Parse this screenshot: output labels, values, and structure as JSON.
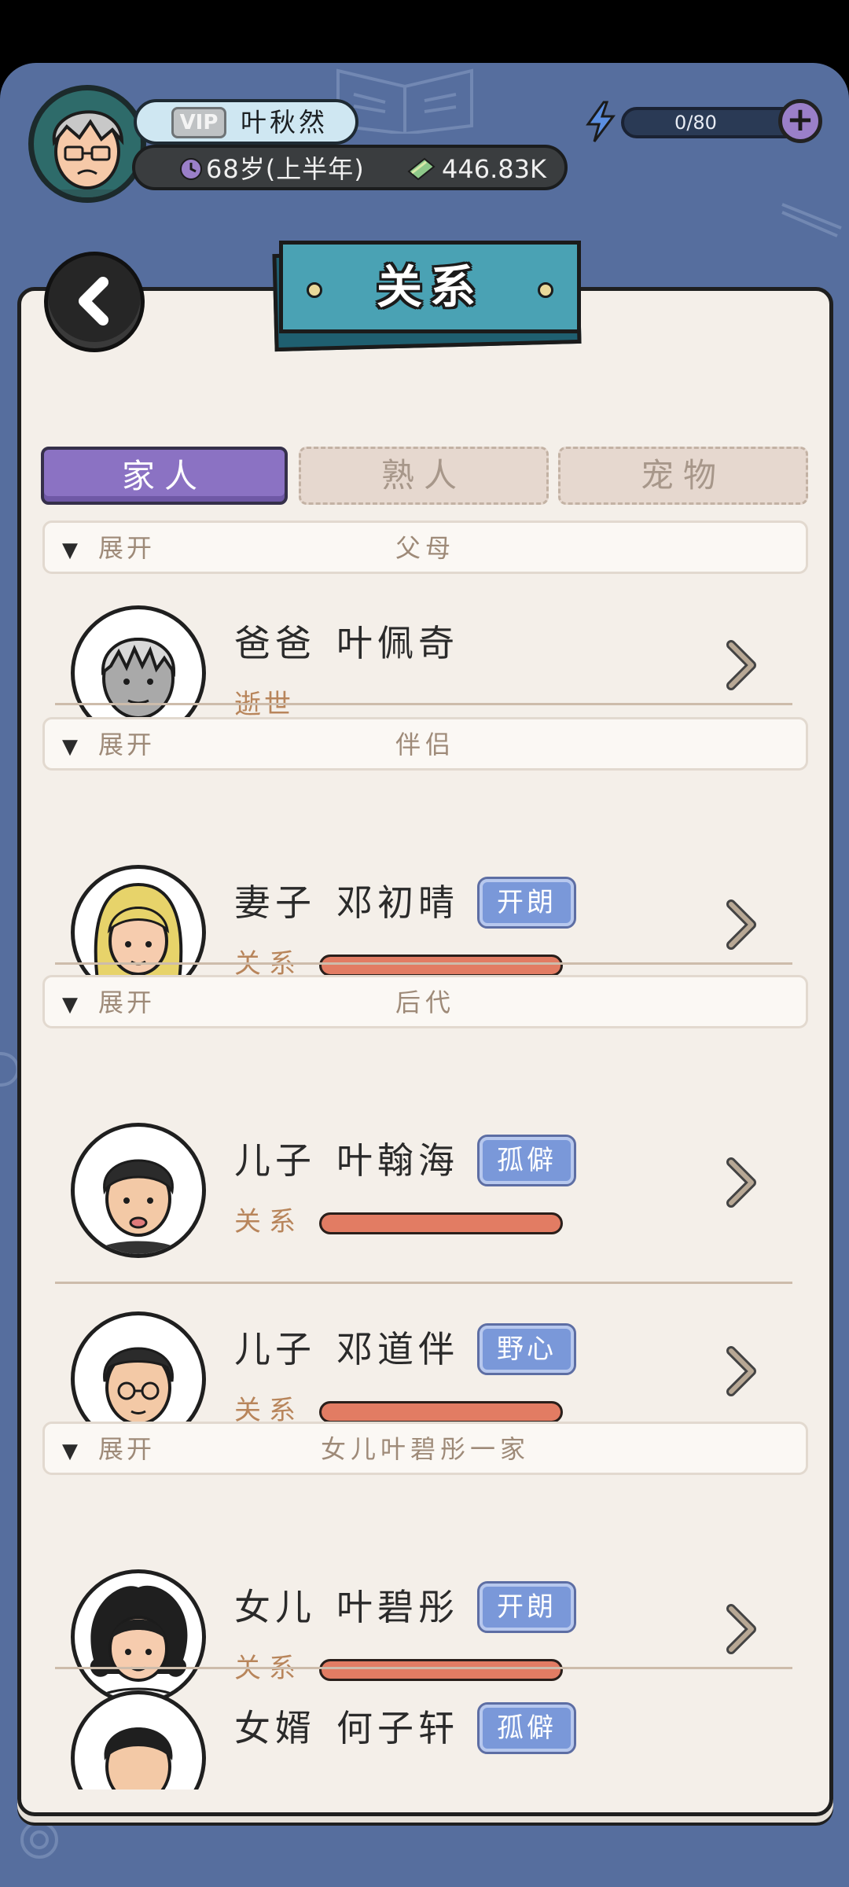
{
  "header": {
    "vip_label": "VIP",
    "player_name": "叶秋然",
    "age_text": "68岁(上半年)",
    "money_text": "446.83K",
    "energy_text": "0/80",
    "energy_value": 0,
    "energy_max": 80
  },
  "page": {
    "title": "关系"
  },
  "tabs": [
    {
      "label": "家人",
      "active": true
    },
    {
      "label": "熟人",
      "active": false
    },
    {
      "label": "宠物",
      "active": false
    }
  ],
  "sections": [
    {
      "expand_label": "展开",
      "title": "父母"
    },
    {
      "expand_label": "展开",
      "title": "伴侣"
    },
    {
      "expand_label": "展开",
      "title": "后代"
    },
    {
      "expand_label": "展开",
      "title": "女儿叶碧彤一家"
    }
  ],
  "people": [
    {
      "role": "爸爸",
      "name": "叶佩奇",
      "status": "逝世",
      "trait": ""
    },
    {
      "role": "妻子",
      "name": "邓初晴",
      "trait": "开朗",
      "relation_label": "关系",
      "relation_value": 1.0
    },
    {
      "role": "儿子",
      "name": "叶翰海",
      "trait": "孤僻",
      "relation_label": "关系",
      "relation_value": 1.0
    },
    {
      "role": "儿子",
      "name": "邓道伴",
      "trait": "野心",
      "relation_label": "关系",
      "relation_value": 1.0
    },
    {
      "role": "女儿",
      "name": "叶碧彤",
      "trait": "开朗",
      "relation_label": "关系",
      "relation_value": 1.0
    },
    {
      "role": "女婿",
      "name": "何子轩",
      "trait": "孤僻"
    }
  ],
  "icons": {
    "back": "arrow-left-icon",
    "age": "clock-icon",
    "money": "cash-icon",
    "energy": "lightning-icon",
    "plus": "plus-icon",
    "row_arrow": "chevron-right-icon"
  },
  "colors": {
    "background": "#566e9e",
    "paper": "#f4efe9",
    "tab_active": "#8b72c3",
    "trait_badge": "#7a98d9",
    "relation_fill": "#e27c63",
    "title_banner": "#4aa2b4"
  }
}
